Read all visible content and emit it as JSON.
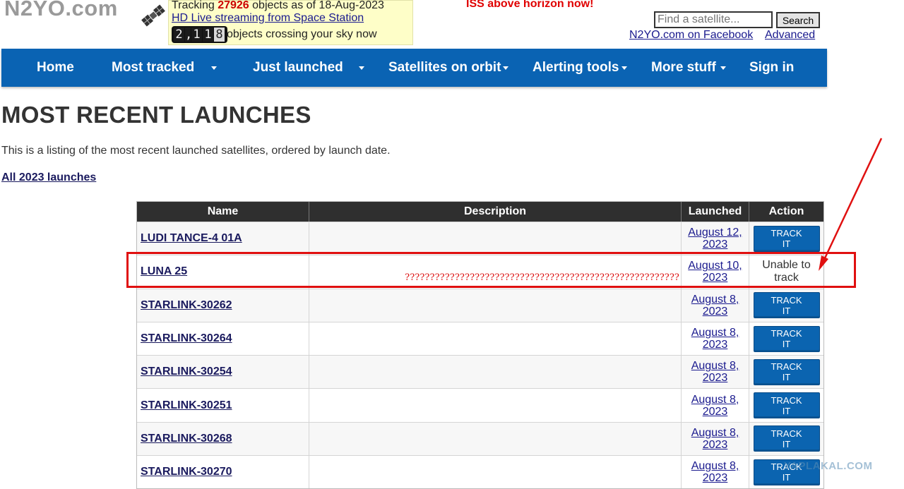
{
  "header": {
    "logo_text": "N2YO.com",
    "tracking_prefix": "Tracking ",
    "tracking_count": "27926",
    "tracking_suffix": " objects as of 18-Aug-2023",
    "live_link": "HD Live streaming from Space Station",
    "counter_digits": [
      "2",
      ",",
      "1",
      "1",
      "8"
    ],
    "counter_text": "objects crossing your sky now",
    "iss_alert": "ISS above horizon now!",
    "search_placeholder": "Find a satellite...",
    "search_button": "Search",
    "facebook_link": "N2YO.com on Facebook",
    "advanced_link": "Advanced"
  },
  "nav": {
    "items": [
      {
        "label": "Home",
        "dropdown": false
      },
      {
        "label": "Most tracked",
        "dropdown": true
      },
      {
        "label": "Just launched",
        "dropdown": true
      },
      {
        "label": "Satellites on orbit",
        "dropdown": true
      },
      {
        "label": "Alerting tools",
        "dropdown": true
      },
      {
        "label": "More stuff",
        "dropdown": true
      },
      {
        "label": "Sign in",
        "dropdown": false
      }
    ]
  },
  "main": {
    "title": "MOST RECENT LAUNCHES",
    "intro": "This is a listing of the most recent launched satellites, ordered by launch date.",
    "all_launches_link": "All 2023 launches"
  },
  "table": {
    "headers": [
      "Name",
      "Description",
      "Launched",
      "Action"
    ],
    "track_label_line1": "TRACK",
    "track_label_line2": "IT",
    "rows": [
      {
        "name": "LUDI TANCE-4 01A",
        "description": "",
        "date_line1": "August 12,",
        "date_line2": "2023",
        "action": "track"
      },
      {
        "name": "LUNA 25",
        "description": "???????????????????????????????????????????????????????",
        "date_line1": "August 10,",
        "date_line2": "2023",
        "action": "Unable to track"
      },
      {
        "name": "STARLINK-30262",
        "description": "",
        "date_line1": "August 8,",
        "date_line2": "2023",
        "action": "track"
      },
      {
        "name": "STARLINK-30264",
        "description": "",
        "date_line1": "August 8,",
        "date_line2": "2023",
        "action": "track"
      },
      {
        "name": "STARLINK-30254",
        "description": "",
        "date_line1": "August 8,",
        "date_line2": "2023",
        "action": "track"
      },
      {
        "name": "STARLINK-30251",
        "description": "",
        "date_line1": "August 8,",
        "date_line2": "2023",
        "action": "track"
      },
      {
        "name": "STARLINK-30268",
        "description": "",
        "date_line1": "August 8,",
        "date_line2": "2023",
        "action": "track"
      },
      {
        "name": "STARLINK-30270",
        "description": "",
        "date_line1": "August 8,",
        "date_line2": "2023",
        "action": "track"
      }
    ]
  },
  "annotation": {
    "highlight_color": "#e01010"
  },
  "watermark": "YAPLAKAL.COM",
  "colors": {
    "nav_blue": "#0a63b3",
    "button_blue": "#0b64b0",
    "alert_red": "#e00000",
    "link_navy": "#1a1a5e"
  }
}
